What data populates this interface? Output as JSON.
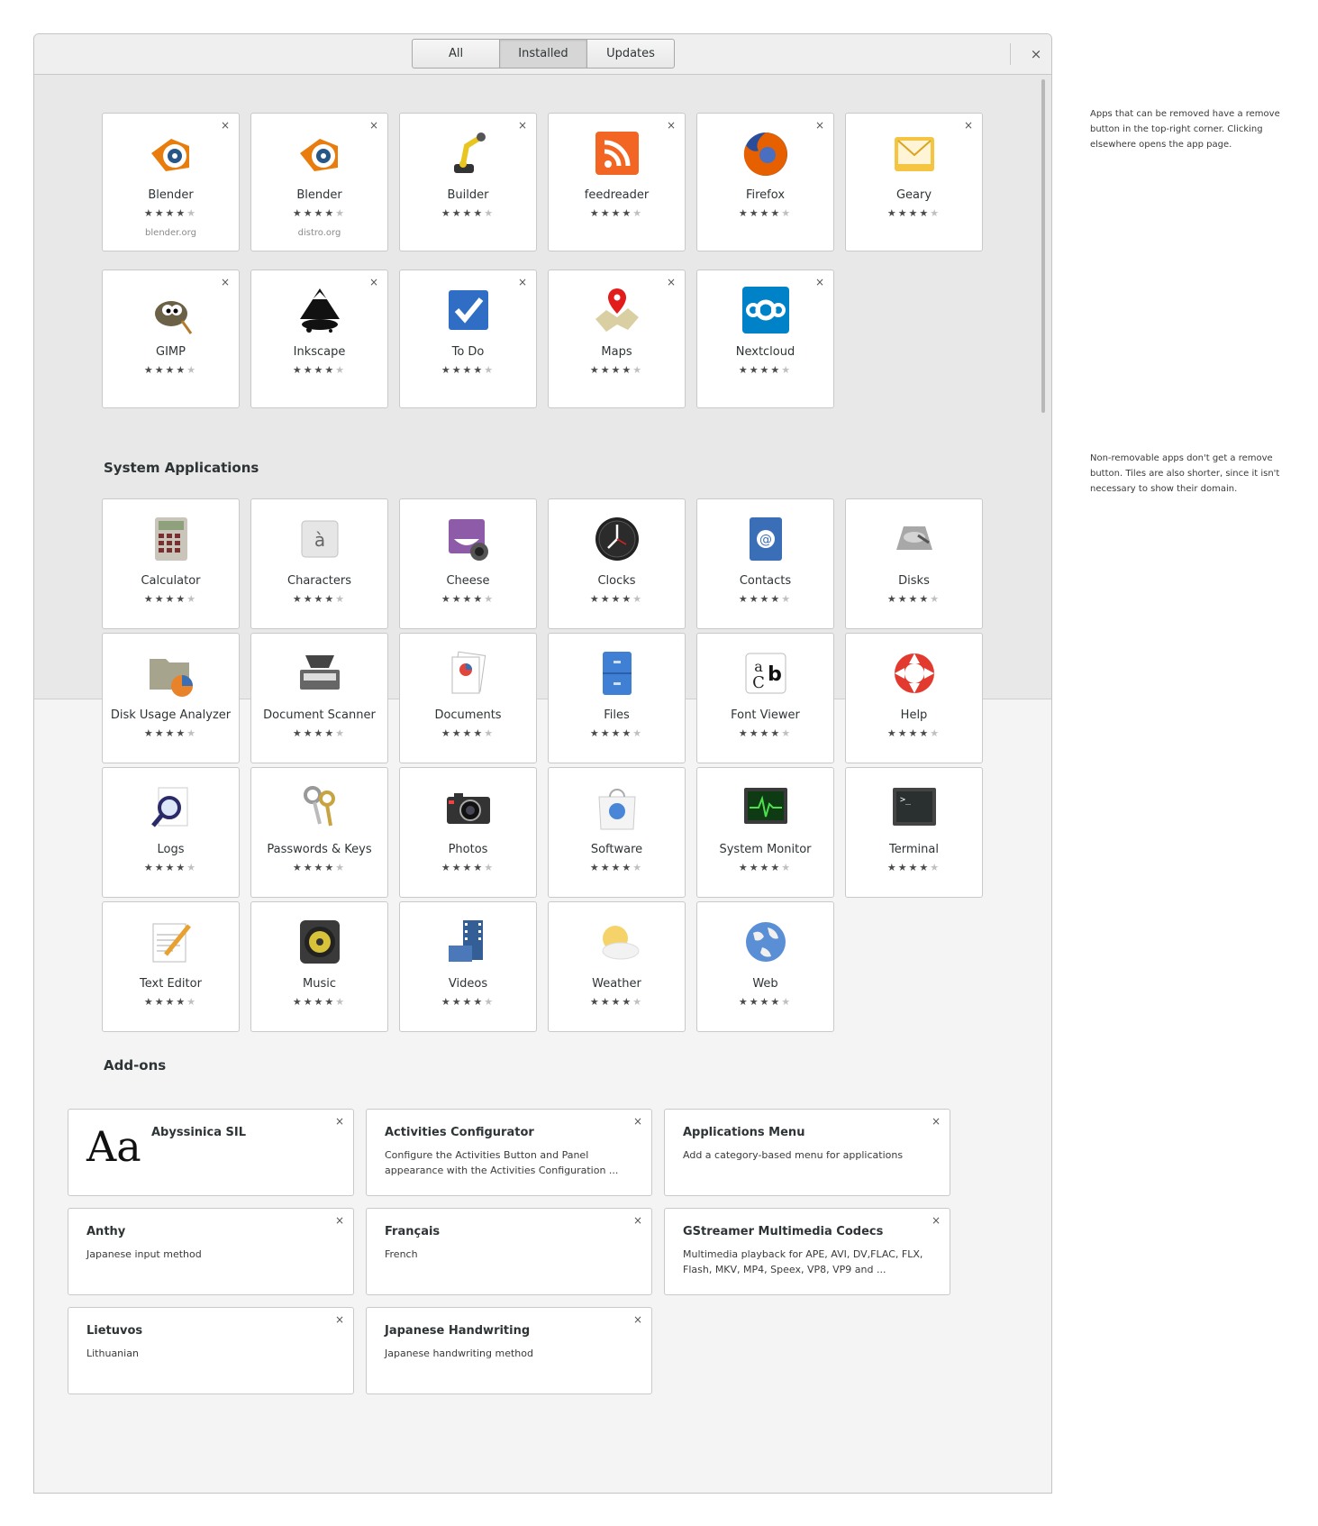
{
  "tabs": [
    "All",
    "Installed",
    "Updates"
  ],
  "active_tab": "Installed",
  "window": {
    "close_label": "×"
  },
  "rating_stars": "★★★★",
  "rating_star_off": "★",
  "remove_label": "×",
  "removable_apps": [
    {
      "name": "Blender",
      "domain": "blender.org",
      "icon": "blender-icon"
    },
    {
      "name": "Blender",
      "domain": "distro.org",
      "icon": "blender-icon"
    },
    {
      "name": "Builder",
      "icon": "builder-icon"
    },
    {
      "name": "feedreader",
      "icon": "rss-icon"
    },
    {
      "name": "Firefox",
      "icon": "firefox-icon"
    },
    {
      "name": "Geary",
      "icon": "mail-icon"
    },
    {
      "name": "GIMP",
      "icon": "gimp-icon"
    },
    {
      "name": "Inkscape",
      "icon": "inkscape-icon"
    },
    {
      "name": "To Do",
      "icon": "checkbox-icon"
    },
    {
      "name": "Maps",
      "icon": "maps-icon"
    },
    {
      "name": "Nextcloud",
      "icon": "nextcloud-icon"
    }
  ],
  "system_section": {
    "title": "System Applications"
  },
  "system_apps": [
    {
      "name": "Calculator",
      "icon": "calculator-icon"
    },
    {
      "name": "Characters",
      "icon": "characters-icon"
    },
    {
      "name": "Cheese",
      "icon": "cheese-icon"
    },
    {
      "name": "Clocks",
      "icon": "clock-icon"
    },
    {
      "name": "Contacts",
      "icon": "contacts-icon"
    },
    {
      "name": "Disks",
      "icon": "disks-icon"
    },
    {
      "name": "Disk Usage Analyzer",
      "icon": "disk-usage-icon"
    },
    {
      "name": "Document Scanner",
      "icon": "scanner-icon"
    },
    {
      "name": "Documents",
      "icon": "documents-icon"
    },
    {
      "name": "Files",
      "icon": "files-icon"
    },
    {
      "name": "Font Viewer",
      "icon": "font-viewer-icon"
    },
    {
      "name": "Help",
      "icon": "help-lifebuoy-icon"
    },
    {
      "name": "Logs",
      "icon": "logs-icon"
    },
    {
      "name": "Passwords & Keys",
      "icon": "keys-icon"
    },
    {
      "name": "Photos",
      "icon": "camera-icon"
    },
    {
      "name": "Software",
      "icon": "software-bag-icon"
    },
    {
      "name": "System Monitor",
      "icon": "system-monitor-icon"
    },
    {
      "name": "Terminal",
      "icon": "terminal-icon"
    },
    {
      "name": "Text Editor",
      "icon": "text-editor-icon"
    },
    {
      "name": "Music",
      "icon": "speaker-icon"
    },
    {
      "name": "Videos",
      "icon": "videos-icon"
    },
    {
      "name": "Weather",
      "icon": "weather-icon"
    },
    {
      "name": "Web",
      "icon": "web-globe-icon"
    }
  ],
  "addons_section": {
    "title": "Add-ons"
  },
  "addons": [
    {
      "name": "Abyssinica SIL",
      "description": "",
      "preview": "Aa"
    },
    {
      "name": "Activities Configurator",
      "description": "Configure the Activities Button and Panel appearance with the Activities Configuration ..."
    },
    {
      "name": "Applications Menu",
      "description": "Add a category-based menu for applications"
    },
    {
      "name": "Anthy",
      "description": "Japanese input method"
    },
    {
      "name": "Français",
      "description": "French"
    },
    {
      "name": "GStreamer Multimedia Codecs",
      "description": "Multimedia playback for APE, AVI, DV,FLAC, FLX, Flash, MKV, MP4, Speex, VP8, VP9 and ..."
    },
    {
      "name": "Lietuvos",
      "description": "Lithuanian"
    },
    {
      "name": "Japanese Handwriting",
      "description": "Japanese handwriting method"
    }
  ],
  "notes": [
    "Apps that can be removed have a remove button in the top-right corner. Clicking elsewhere opens the app page.",
    "Non-removable apps don't get a remove button. Tiles are also shorter, since it isn't necessary to show their domain."
  ]
}
